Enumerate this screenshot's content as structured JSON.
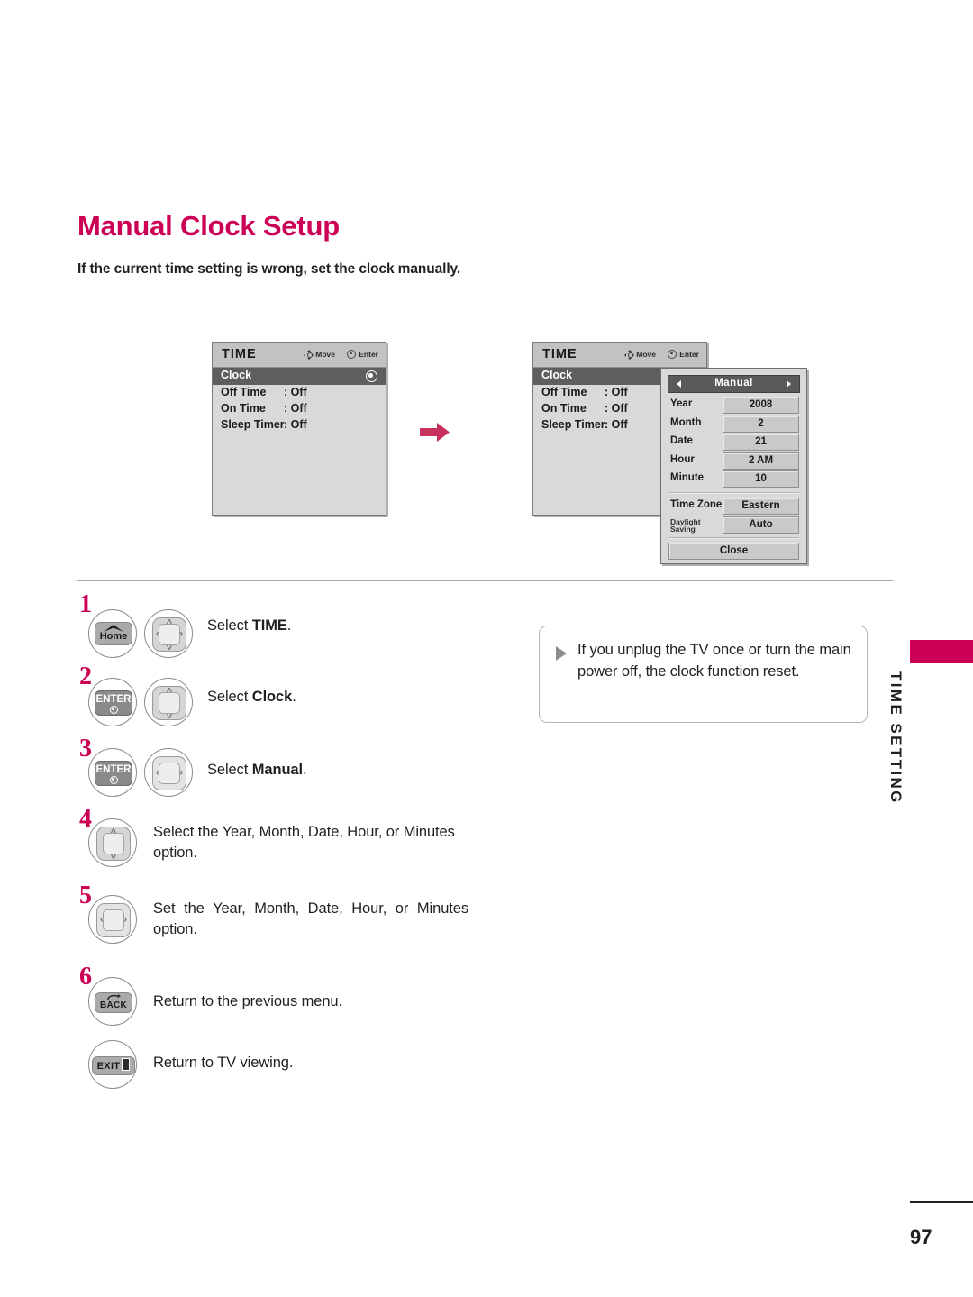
{
  "page": {
    "title": "Manual Clock Setup",
    "subtitle": "If the current time setting is wrong, set the clock manually.",
    "number": "97",
    "side_tab": "TIME SETTING",
    "accent_color": "#cc0055"
  },
  "osd_before": {
    "title": "TIME",
    "hint_move": "Move",
    "hint_enter": "Enter",
    "rows": [
      {
        "label": "Clock",
        "value": "",
        "selected": true
      },
      {
        "label": "Off Time",
        "value": ": Off",
        "selected": false
      },
      {
        "label": "On Time",
        "value": ": Off",
        "selected": false
      },
      {
        "label": "Sleep Timer",
        "value": ": Off",
        "selected": false
      }
    ]
  },
  "osd_after": {
    "title": "TIME",
    "hint_move": "Move",
    "hint_enter": "Enter",
    "rows": [
      {
        "label": "Clock",
        "value": "",
        "selected": true
      },
      {
        "label": "Off Time",
        "value": ": Off",
        "selected": false
      },
      {
        "label": "On Time",
        "value": ": Off",
        "selected": false
      },
      {
        "label": "Sleep Timer",
        "value": ": Off",
        "selected": false
      }
    ]
  },
  "manual_dialog": {
    "header": "Manual",
    "fields": [
      {
        "label": "Year",
        "value": "2008"
      },
      {
        "label": "Month",
        "value": "2"
      },
      {
        "label": "Date",
        "value": "21"
      },
      {
        "label": "Hour",
        "value": "2 AM"
      },
      {
        "label": "Minute",
        "value": "10"
      }
    ],
    "zone_fields": [
      {
        "label": "Time Zone",
        "value": "Eastern"
      },
      {
        "label": "Daylight Saving",
        "label_line1": "Daylight",
        "label_line2": "Saving",
        "value": "Auto"
      }
    ],
    "close_label": "Close"
  },
  "steps": [
    {
      "num": "1",
      "keys": [
        "Home",
        "dpad-updown-leftright"
      ],
      "text_plain": "Select ",
      "text_bold": "TIME",
      "text_tail": "."
    },
    {
      "num": "2",
      "keys": [
        "ENTER",
        "dpad-updown"
      ],
      "text_plain": "Select ",
      "text_bold": "Clock",
      "text_tail": "."
    },
    {
      "num": "3",
      "keys": [
        "ENTER",
        "dpad-leftright"
      ],
      "text_plain": "Select ",
      "text_bold": "Manual",
      "text_tail": "."
    },
    {
      "num": "4",
      "keys": [
        "dpad-updown"
      ],
      "text_plain": "Select the Year, Month, Date, Hour, or Minutes option."
    },
    {
      "num": "5",
      "keys": [
        "dpad-leftright"
      ],
      "text_plain": "Set the Year, Month, Date, Hour, or Minutes option."
    },
    {
      "num": "6",
      "keys": [
        "BACK"
      ],
      "text_plain": "Return to the previous menu."
    },
    {
      "num": "",
      "keys": [
        "EXIT"
      ],
      "text_plain": "Return to TV viewing."
    }
  ],
  "key_labels": {
    "home": "Home",
    "enter": "ENTER",
    "back": "BACK",
    "exit": "EXIT"
  },
  "note": {
    "text": "If you unplug the TV once or turn the main power off, the clock function reset."
  }
}
